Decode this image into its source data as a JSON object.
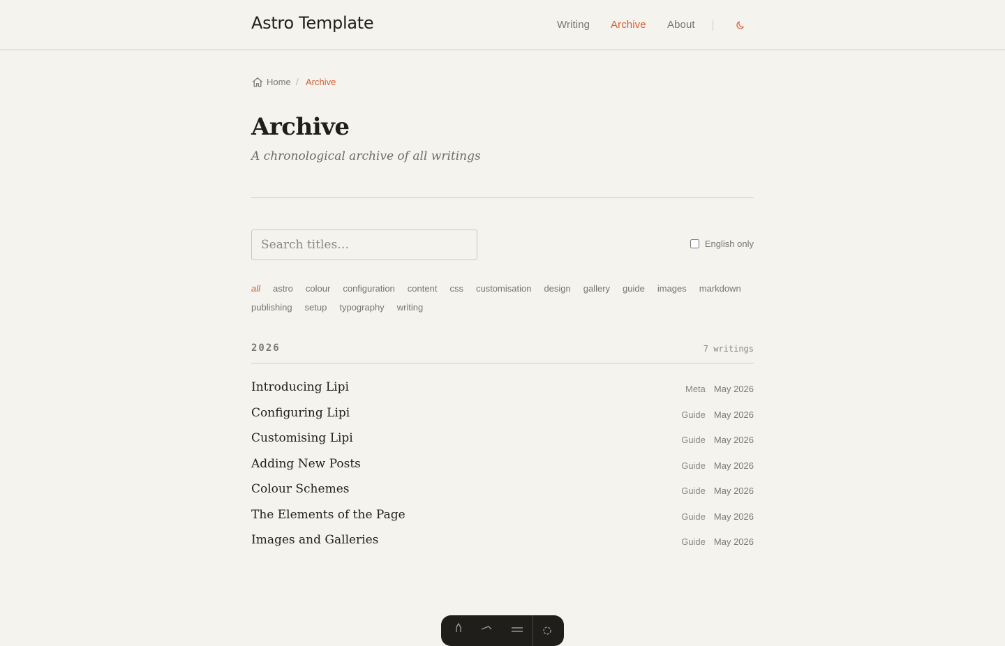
{
  "header": {
    "site_title": "Astro Template",
    "nav": [
      {
        "label": "Writing",
        "active": false
      },
      {
        "label": "Archive",
        "active": true
      },
      {
        "label": "About",
        "active": false
      }
    ],
    "theme_toggle_icon": "moon-icon"
  },
  "breadcrumb": {
    "home_icon": "home-icon",
    "home": "Home",
    "separator": "/",
    "current": "Archive"
  },
  "page": {
    "title": "Archive",
    "subtitle": "A chronological archive of all writings"
  },
  "filters": {
    "search_placeholder": "Search titles…",
    "english_only_label": "English only",
    "english_only_checked": false,
    "tags": [
      "all",
      "astro",
      "colour",
      "configuration",
      "content",
      "css",
      "customisation",
      "design",
      "gallery",
      "guide",
      "images",
      "markdown",
      "publishing",
      "setup",
      "typography",
      "writing"
    ],
    "active_tag": "all"
  },
  "archive": {
    "year": "2026",
    "count_label": "7 writings",
    "posts": [
      {
        "title": "Introducing Lipi",
        "category": "Meta",
        "date": "May 2026"
      },
      {
        "title": "Configuring Lipi",
        "category": "Guide",
        "date": "May 2026"
      },
      {
        "title": "Customising Lipi",
        "category": "Guide",
        "date": "May 2026"
      },
      {
        "title": "Adding New Posts",
        "category": "Guide",
        "date": "May 2026"
      },
      {
        "title": "Colour Schemes",
        "category": "Guide",
        "date": "May 2026"
      },
      {
        "title": "The Elements of the Page",
        "category": "Guide",
        "date": "May 2026"
      },
      {
        "title": "Images and Galleries",
        "category": "Guide",
        "date": "May 2026"
      }
    ]
  },
  "colors": {
    "background": "#f4f3ee",
    "text": "#1f1e1b",
    "muted": "#77756f",
    "accent": "#d25f36",
    "rule": "#cfcdc6",
    "dock": "#1f1e1b"
  }
}
